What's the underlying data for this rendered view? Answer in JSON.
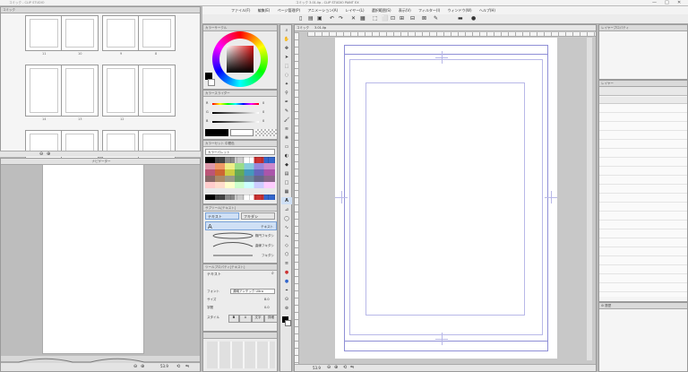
{
  "app": {
    "title_left": "コミック - CLIP STUDIO",
    "title_main": "コミック 3.01.lip - CLIP STUDIO PAINT EX",
    "window_controls": [
      "—",
      "□",
      "✕"
    ]
  },
  "menu": [
    "ファイル(F)",
    "編集(E)",
    "ページ管理(P)",
    "アニメーション(A)",
    "レイヤー(L)",
    "選択範囲(S)",
    "表示(V)",
    "フィルター(I)",
    "ウィンドウ(W)",
    "ヘルプ(H)"
  ],
  "page_manager": {
    "title": "コミック",
    "pages": [
      "11",
      "10",
      "9",
      "8",
      "14",
      "13",
      "12",
      "",
      "",
      "",
      ""
    ]
  },
  "navigator": {
    "title": "ナビゲーター"
  },
  "color_wheel": {
    "title": "カラーサークル"
  },
  "color_slider": {
    "title": "カラースライダー",
    "values": [
      "R",
      "G",
      "B"
    ],
    "numbers": [
      "0",
      "0",
      "0"
    ]
  },
  "color_set": {
    "title": "カラーセット",
    "tab2": "中間色",
    "palette_name": "カラーパレット"
  },
  "subtool": {
    "title": "サブツール[テキスト]",
    "tabs": [
      "テキスト",
      "フキダシ"
    ],
    "items": [
      "テキスト",
      "楕円フキダシ",
      "曲線フキダシ",
      "フキダシ"
    ]
  },
  "tool_property": {
    "title": "ツールプロパティ[テキスト]",
    "name": "テキスト",
    "rows": [
      {
        "label": "フォント",
        "value": "源暎アンチック Ultra"
      },
      {
        "label": "サイズ",
        "value": "8.0"
      },
      {
        "label": "字間",
        "value": "0.0"
      },
      {
        "label": "スタイル",
        "value": "B"
      }
    ],
    "style_buttons": [
      "A",
      "文字",
      "詳細"
    ]
  },
  "layer_panel": {
    "title": "レイヤープロパティ",
    "title2": "レイヤー",
    "title3": "履歴"
  },
  "canvas": {
    "tab": "コミック",
    "tab2": "3.01.lip",
    "zoom": "53.9"
  },
  "status": {
    "zoom": "53.9"
  },
  "colors": {
    "accent": "#3f7de0",
    "canvas_bg": "#c8c8c8"
  }
}
